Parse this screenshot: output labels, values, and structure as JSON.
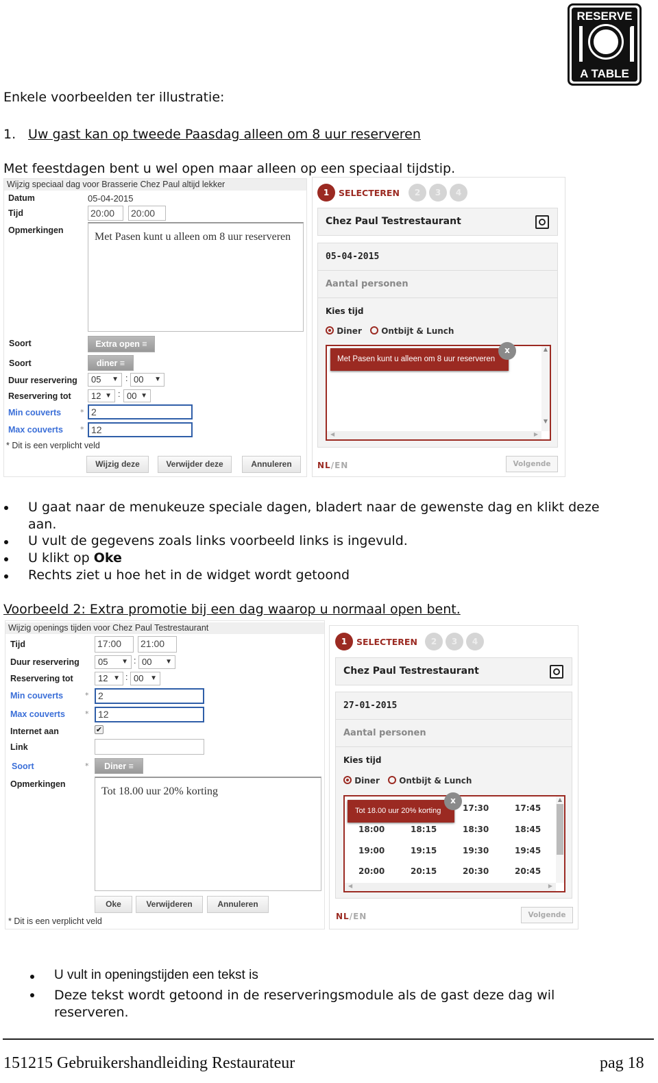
{
  "logo": {
    "text_top": "RESERVE",
    "text_bottom": "A TABLE",
    "icon": "plate-fork-knife-icon"
  },
  "intro": "Enkele voorbeelden ter illustratie:",
  "example1": {
    "number": "1.",
    "heading": "Uw gast kan op tweede Paasdag alleen om 8 uur reserveren",
    "lead": "Met feestdagen bent u wel open maar alleen op een speciaal tijdstip."
  },
  "form1": {
    "title": "Wijzig speciaal dag voor Brasserie Chez Paul altijd lekker",
    "datum_label": "Datum",
    "datum_value": "05-04-2015",
    "tijd_label": "Tijd",
    "tijd_from": "20:00",
    "tijd_to": "20:00",
    "opmerkingen_label": "Opmerkingen",
    "opmerkingen_value": "Met Pasen kunt u alleen om 8 uur reserveren",
    "soort_label": "Soort",
    "soort1_value": "Extra open ≡",
    "soort2_value": "diner ≡",
    "duur_label": "Duur reservering",
    "duur_h": "05",
    "duur_m": "00",
    "tot_label": "Reservering tot",
    "tot_h": "12",
    "tot_m": "00",
    "min_label": "Min couverts",
    "min_value": "2",
    "max_label": "Max couverts",
    "max_value": "12",
    "required": "*",
    "required_note": "* Dit is een verplicht veld",
    "buttons": [
      "Wijzig deze",
      "Verwijder deze",
      "Annuleren"
    ]
  },
  "widget1": {
    "step1": "1",
    "step_label": "SELECTEREN",
    "steps": [
      "2",
      "3",
      "4"
    ],
    "restaurant": "Chez Paul Testrestaurant",
    "date": "05-04-2015",
    "persons": "Aantal personen",
    "kies_tijd": "Kies tijd",
    "radio1": "Diner",
    "radio2": "Ontbijt & Lunch",
    "message": "Met Pasen kunt u alleen om 8 uur reserveren",
    "close": "x",
    "lang_nl": "NL",
    "lang_sep": "/",
    "lang_en": "EN",
    "next": "Volgende",
    "accent": "#9b2a22"
  },
  "bullets1": [
    "U gaat naar de menukeuze speciale dagen, bladert naar de gewenste dag en klikt deze aan.",
    "U vult de gegevens zoals links voorbeeld links is ingevuld.",
    "U klikt op ",
    "Rechts ziet u hoe het in de widget wordt getoond"
  ],
  "bullet_oke": "Oke",
  "example2": {
    "heading": "Voorbeeld 2: Extra promotie bij een dag waarop u normaal open bent."
  },
  "form2": {
    "title": "Wijzig openings tijden voor Chez Paul Testrestaurant",
    "tijd_label": "Tijd",
    "tijd_from": "17:00",
    "tijd_to": "21:00",
    "duur_label": "Duur reservering",
    "duur_h": "05",
    "duur_m": "00",
    "tot_label": "Reservering tot",
    "tot_h": "12",
    "tot_m": "00",
    "min_label": "Min couverts",
    "min_value": "2",
    "max_label": "Max couverts",
    "max_value": "12",
    "internet_label": "Internet aan",
    "internet_checked": true,
    "link_label": "Link",
    "link_value": "",
    "soort_label": "Soort",
    "soort_value": "Diner ≡",
    "opmerkingen_label": "Opmerkingen",
    "opmerkingen_value": "Tot 18.00 uur 20% korting",
    "required": "*",
    "buttons": [
      "Oke",
      "Verwijderen",
      "Annuleren"
    ],
    "required_note": "* Dit is een verplicht veld"
  },
  "widget2": {
    "step1": "1",
    "step_label": "SELECTEREN",
    "steps": [
      "2",
      "3",
      "4"
    ],
    "restaurant": "Chez Paul Testrestaurant",
    "date": "27-01-2015",
    "persons": "Aantal personen",
    "kies_tijd": "Kies tijd",
    "radio1": "Diner",
    "radio2": "Ontbijt & Lunch",
    "message": "Tot 18.00 uur 20% korting",
    "close": "x",
    "times": [
      [
        "17:30",
        "17:45"
      ],
      [
        "18:00",
        "18:15",
        "18:30",
        "18:45"
      ],
      [
        "19:00",
        "19:15",
        "19:30",
        "19:45"
      ],
      [
        "20:00",
        "20:15",
        "20:30",
        "20:45"
      ]
    ],
    "lang_nl": "NL",
    "lang_sep": "/",
    "lang_en": "EN",
    "next": "Volgende"
  },
  "bullets2": [
    "U vult in openingstijden een tekst is",
    "Deze tekst wordt getoond in de reserveringsmodule als de gast deze dag wil reserveren."
  ],
  "footer": {
    "left": "151215 Gebruikershandleiding Restaurateur",
    "right": "pag 18"
  }
}
